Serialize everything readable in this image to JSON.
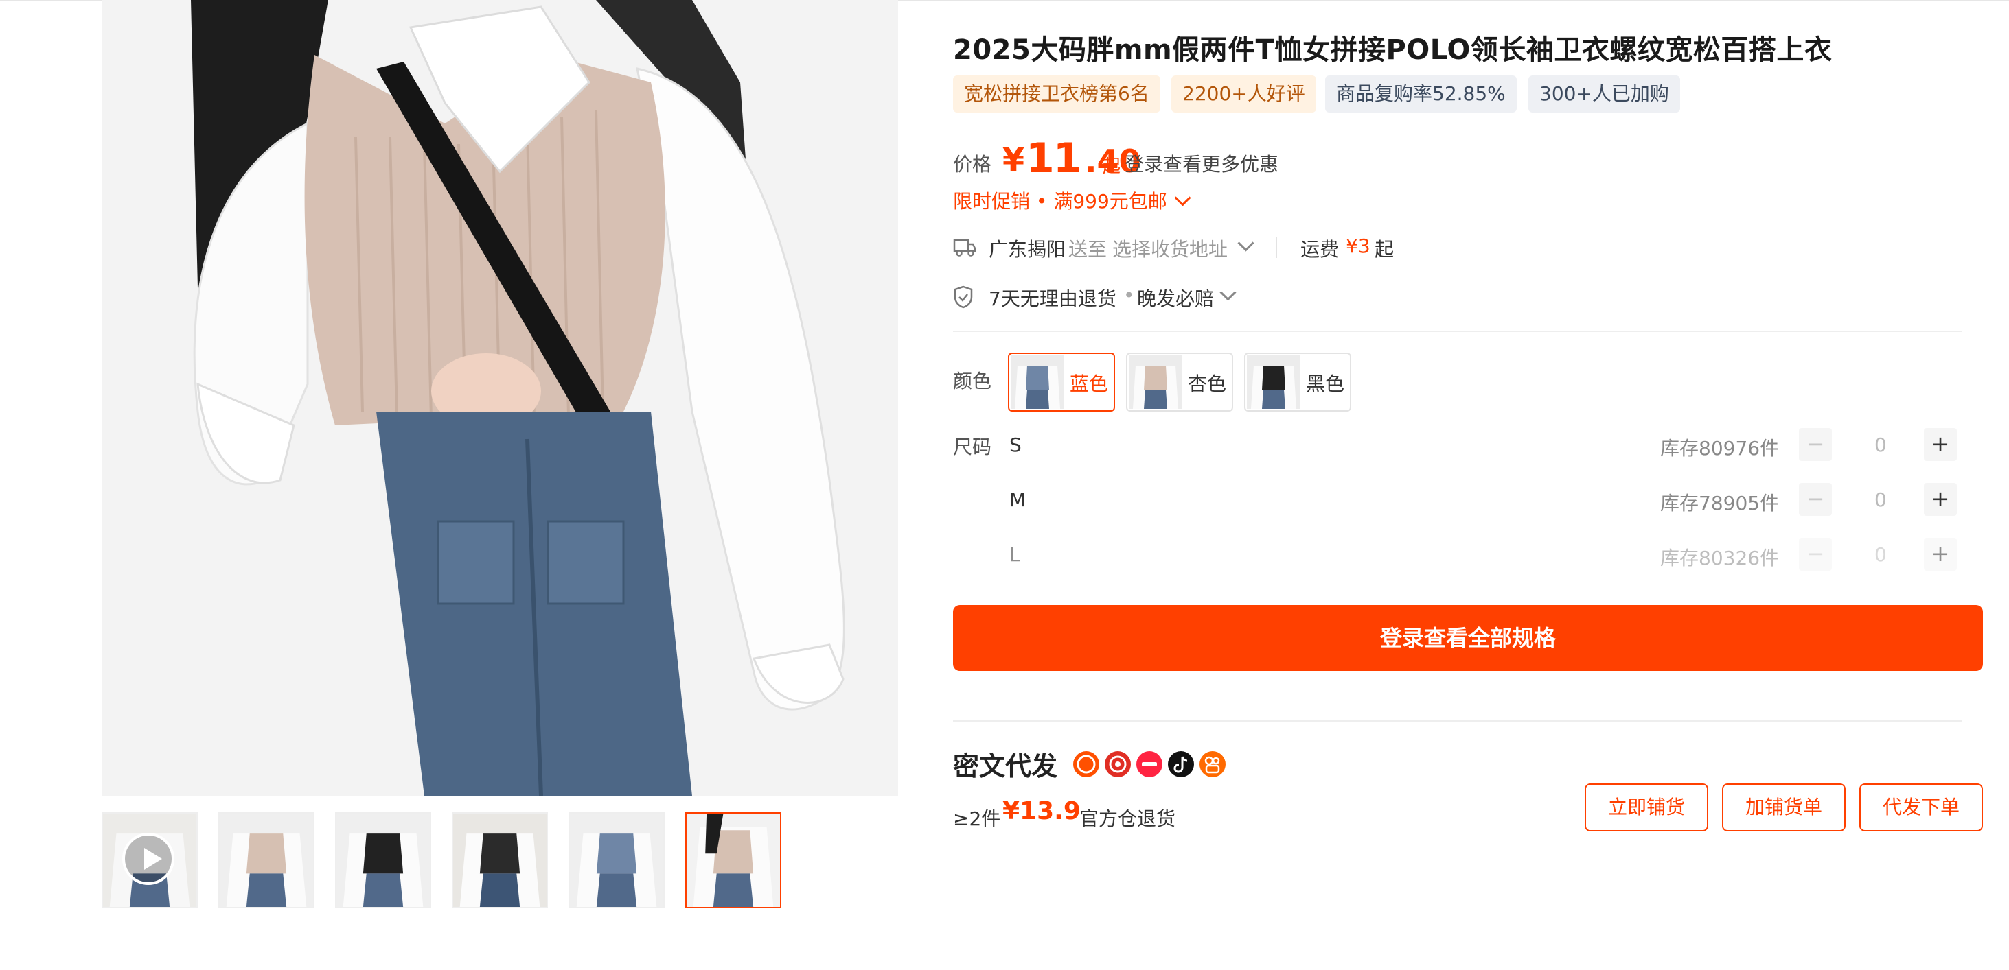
{
  "product": {
    "title": "2025大码胖mm假两件T恤女拼接POLO领长袖卫衣螺纹宽松百搭上衣",
    "tags": [
      "宽松拼接卫衣榜第6名",
      "2200+人好评",
      "商品复购率52.85%",
      "300+人已加购"
    ]
  },
  "price": {
    "label": "价格",
    "currency": "¥",
    "integer": "11",
    "decimal": ".40",
    "suffix": "起",
    "more_offers": "登录查看更多优惠"
  },
  "promo": {
    "text": "限时促销 • 满999元包邮"
  },
  "shipping": {
    "origin": "广东揭阳",
    "send_to": "送至",
    "address_placeholder": "选择收货地址",
    "fee_label": "运费",
    "fee_value": "¥3",
    "fee_suffix": "起"
  },
  "guarantee": {
    "return_policy": "7天无理由退货",
    "separator": "•",
    "late_shipment": "晚发必赔"
  },
  "colors": {
    "label": "颜色",
    "options": [
      {
        "name": "蓝色",
        "selected": true
      },
      {
        "name": "杏色",
        "selected": false
      },
      {
        "name": "黑色",
        "selected": false
      }
    ]
  },
  "sizes": {
    "label": "尺码",
    "rows": [
      {
        "size": "S",
        "stock": "库存80976件",
        "qty": "0"
      },
      {
        "size": "M",
        "stock": "库存78905件",
        "qty": "0"
      },
      {
        "size": "L",
        "stock": "库存80326件",
        "qty": "0"
      }
    ],
    "minus_symbol": "−",
    "plus_symbol": "+"
  },
  "cta": {
    "label": "登录查看全部规格"
  },
  "dropship": {
    "title": "密文代发",
    "platform_icons": [
      "taobao-icon",
      "pinduoduo-icon",
      "xiaohongshu-icon",
      "douyin-icon",
      "kuaishou-icon"
    ],
    "min_qty": "≥2件",
    "price": "¥13.9",
    "return_note": "官方仓退货",
    "buttons": [
      "立即铺货",
      "加铺货单",
      "代发下单"
    ]
  },
  "colors_theme": {
    "accent": "#ff4000",
    "tag_warm_bg": "#fff2e2",
    "tag_cool_bg": "#eef0f4"
  }
}
